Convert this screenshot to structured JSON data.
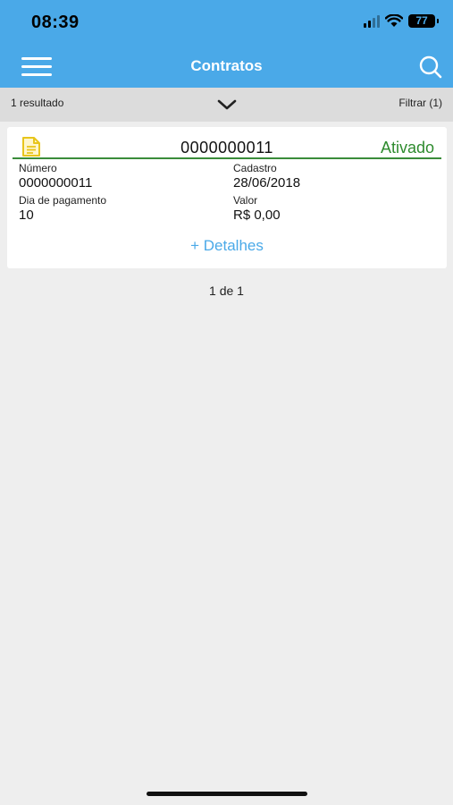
{
  "status_bar": {
    "time": "08:39",
    "battery": "77"
  },
  "header": {
    "title": "Contratos",
    "menu_icon": "hamburger-menu-icon",
    "search_icon": "search-icon"
  },
  "filter_bar": {
    "results": "1 resultado",
    "filter_label": "Filtrar (1)",
    "toggle_icon": "chevron-down-icon"
  },
  "contract": {
    "icon": "document-icon",
    "number_title": "0000000011",
    "status": "Ativado",
    "fields": {
      "numero_label": "Número",
      "numero_value": "0000000011",
      "cadastro_label": "Cadastro",
      "cadastro_value": "28/06/2018",
      "dia_label": "Dia de pagamento",
      "dia_value": "10",
      "valor_label": "Valor",
      "valor_value": "R$ 0,00"
    },
    "details_link": "+ Detalhes"
  },
  "pagination": {
    "text": "1 de 1"
  },
  "colors": {
    "primary": "#4aa9e8",
    "status_active": "#2e8b2e",
    "document_icon": "#e8c51c",
    "background": "#eeeeee"
  }
}
